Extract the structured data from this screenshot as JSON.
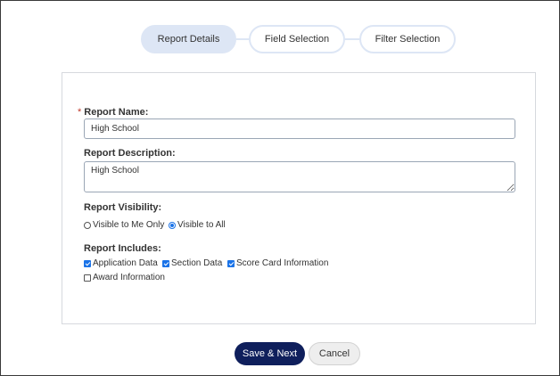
{
  "stepper": {
    "steps": [
      {
        "label": "Report Details",
        "active": true
      },
      {
        "label": "Field Selection",
        "active": false
      },
      {
        "label": "Filter Selection",
        "active": false
      }
    ]
  },
  "form": {
    "required_mark": "*",
    "report_name": {
      "label": "Report Name:",
      "value": "High School"
    },
    "report_description": {
      "label": "Report Description:",
      "value": "High School"
    },
    "visibility": {
      "label": "Report Visibility:",
      "options": [
        {
          "label": "Visible to Me Only",
          "selected": false
        },
        {
          "label": "Visible to All",
          "selected": true
        }
      ]
    },
    "includes": {
      "label": "Report Includes:",
      "options": [
        {
          "label": "Application Data",
          "checked": true
        },
        {
          "label": "Section Data",
          "checked": true
        },
        {
          "label": "Score Card Information",
          "checked": true
        },
        {
          "label": "Award Information",
          "checked": false
        }
      ]
    }
  },
  "actions": {
    "save_label": "Save & Next",
    "cancel_label": "Cancel"
  },
  "colors": {
    "primary": "#0f1f5c",
    "accent": "#1a73e8",
    "step_active_bg": "#dde6f5"
  }
}
